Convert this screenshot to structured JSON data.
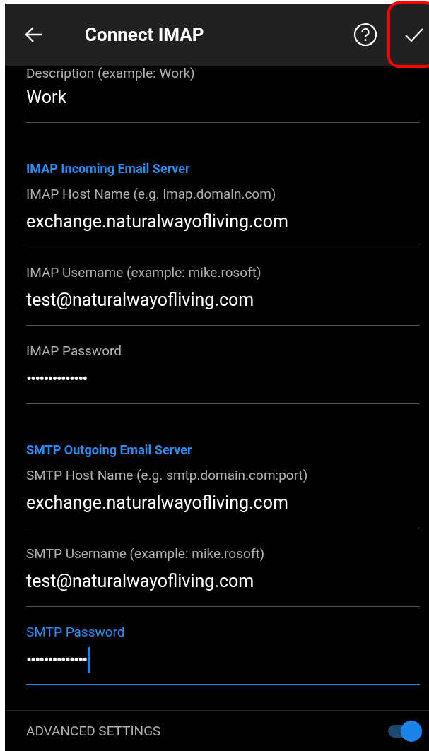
{
  "app_bar": {
    "title": "Connect IMAP",
    "done_highlighted": true
  },
  "description_field": {
    "label": "Description (example: Work)",
    "value": "Work",
    "focused": false
  },
  "sections": [
    {
      "title": "IMAP Incoming Email Server",
      "fields": [
        {
          "label": "IMAP Host Name (e.g. imap.domain.com)",
          "value": "exchange.naturalwayofliving.com",
          "kind": "text",
          "focused": false
        },
        {
          "label": "IMAP Username (example: mike.rosoft)",
          "value": "test@naturalwayofliving.com",
          "kind": "text",
          "focused": false
        },
        {
          "label": "IMAP Password",
          "value": "••••••••••••••",
          "kind": "password",
          "focused": false
        }
      ]
    },
    {
      "title": "SMTP Outgoing Email Server",
      "fields": [
        {
          "label": "SMTP Host Name (e.g. smtp.domain.com:port)",
          "value": "exchange.naturalwayofliving.com",
          "kind": "text",
          "focused": false
        },
        {
          "label": "SMTP Username (example: mike.rosoft)",
          "value": "test@naturalwayofliving.com",
          "kind": "text",
          "focused": false
        },
        {
          "label": "SMTP Password",
          "value": "••••••••••••••",
          "kind": "password",
          "focused": true
        }
      ]
    }
  ],
  "advanced_settings": {
    "label": "ADVANCED SETTINGS",
    "on": true
  }
}
